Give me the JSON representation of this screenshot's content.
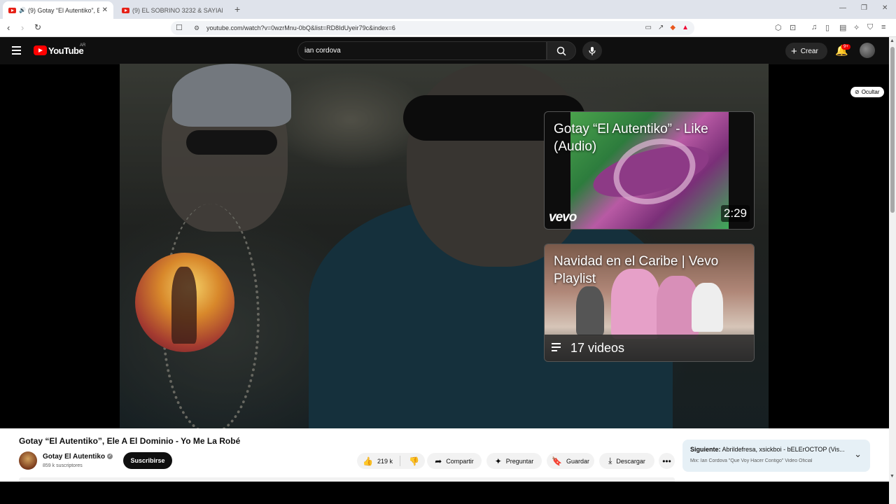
{
  "browser": {
    "tabs": [
      {
        "title": "(9) Gotay “El Autentiko”, Ele A",
        "active": true
      },
      {
        "title": "(9) EL SOBRINO 3232 & SAYIAN JIMI",
        "active": false
      }
    ],
    "url": "youtube.com/watch?v=0wzrMnu-0bQ&list=RD8IdUyeir79c&index=6"
  },
  "header": {
    "logo_text": "YouTube",
    "country": "AR",
    "search_value": "ian cordova",
    "create_label": "Crear",
    "notif_count": "9+"
  },
  "player": {
    "hide_label": "Ocultar",
    "endcards": [
      {
        "title": "Gotay “El Autentiko” - Like (Audio)",
        "duration": "2:29",
        "brand": "vevo"
      },
      {
        "title": "Navidad en el Caribe | Vevo Playlist",
        "count": "17 videos"
      }
    ]
  },
  "video": {
    "title": "Gotay “El Autentiko”, Ele A El Dominio - Yo Me La Robé",
    "channel": "Gotay El Autentiko",
    "subscribers": "859 k suscriptores",
    "subscribe_label": "Suscribirse",
    "likes": "219 k",
    "share_label": "Compartir",
    "ask_label": "Preguntar",
    "save_label": "Guardar",
    "download_label": "Descargar"
  },
  "next_up": {
    "label": "Siguiente:",
    "title": "Abrildefresa, xsickboi - bELErOCTOP (Vis...",
    "mix": "Mix: Ian Cordova \"Que Voy Hacer Contigo\" Video Oficial"
  }
}
